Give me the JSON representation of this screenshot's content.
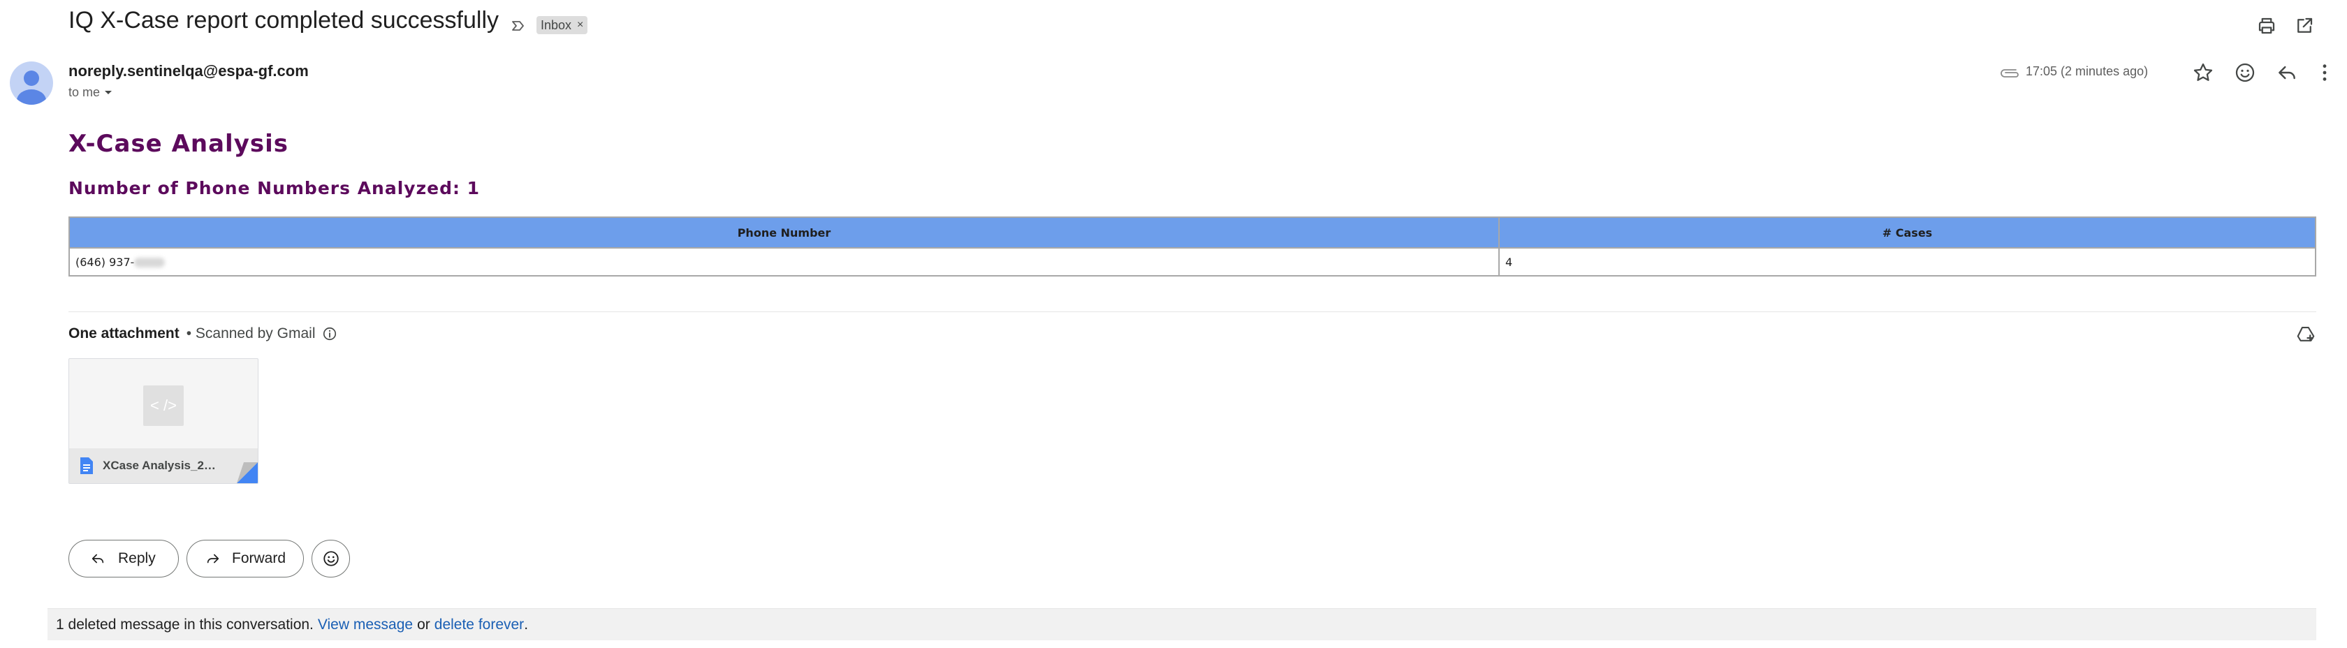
{
  "email": {
    "subject": "IQ X-Case report completed successfully",
    "label": "Inbox",
    "label_remove": "×",
    "sender": "noreply.sentinelqa@espa-gf.com",
    "recipient": "to me",
    "time": "17:05 (2 minutes ago)"
  },
  "body": {
    "title": "X-Case Analysis",
    "subtitle": "Number of Phone Numbers Analyzed: 1",
    "table": {
      "headers": [
        "Phone Number",
        "# Cases"
      ],
      "rows": [
        {
          "phone": "(646) 937-",
          "cases": "4"
        }
      ]
    }
  },
  "attachments": {
    "title": "One attachment",
    "scanned": "• Scanned by Gmail",
    "file_name": "XCase Analysis_2…",
    "thumb_glyph": "< />"
  },
  "actions": {
    "reply": "Reply",
    "forward": "Forward"
  },
  "deleted_notice": {
    "text": "1 deleted message in this conversation.",
    "view": "View message",
    "or": "or",
    "delete": "delete forever",
    "period": "."
  },
  "colors": {
    "heading": "#5c0a5c",
    "table_header": "#6d9eeb",
    "link": "#1a5fb4",
    "doc_icon": "#4285f4"
  },
  "icons": [
    "importance-icon",
    "print-icon",
    "open-in-new-window-icon",
    "attachment-icon",
    "star-icon",
    "emoji-icon",
    "reply-icon",
    "more-vert-icon",
    "add-to-drive-icon",
    "info-icon",
    "doc-icon",
    "forward-icon"
  ]
}
